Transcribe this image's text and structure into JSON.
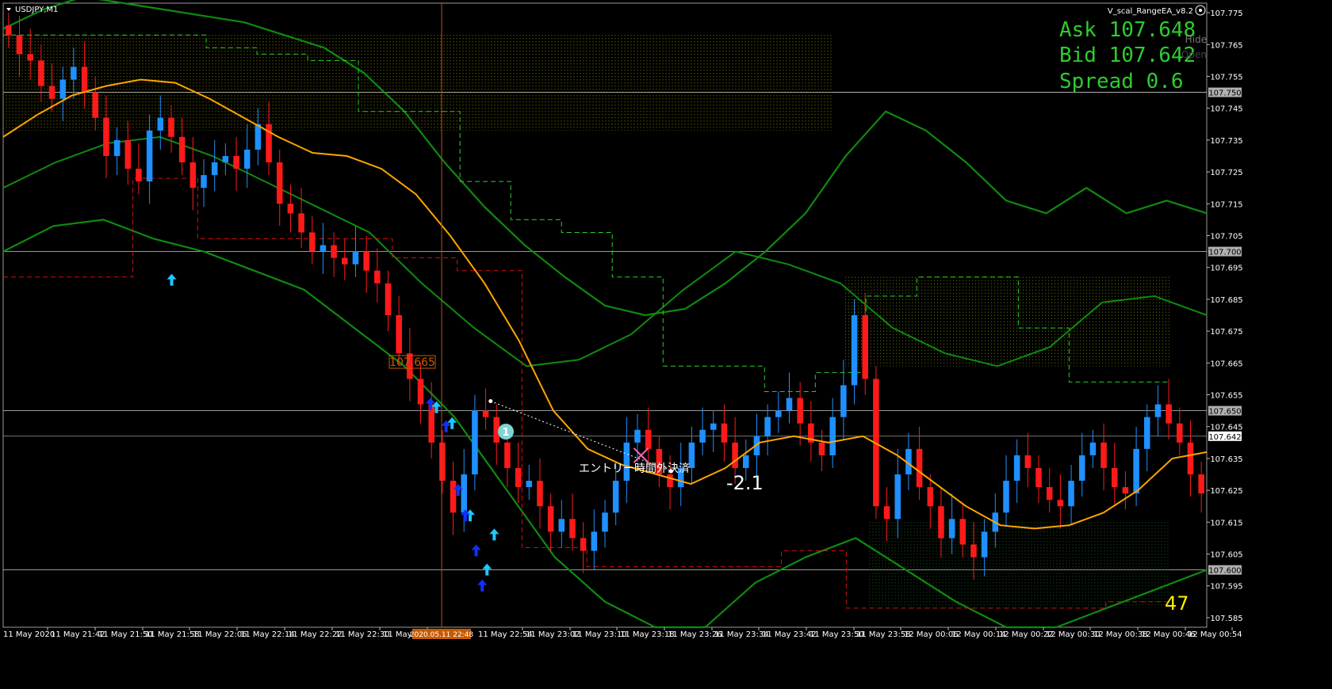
{
  "window": {
    "symbol_title": "USDJPY,M1",
    "ea_name": "V_scal_RangeEA_v8.2",
    "hide_label": "Hide",
    "open_label": "Open"
  },
  "panel": {
    "ask": "Ask 107.648",
    "bid": "Bid 107.642",
    "spread": "Spread 0.6"
  },
  "annotations": {
    "price_label": "107.665",
    "trade_number": "1",
    "exit_text": "エントリー時間外決済",
    "profit_text": "-2.1",
    "counter": "47",
    "crosshair_time": "2020.05.11 22:48"
  },
  "colors": {
    "bull": "#1e90ff",
    "bear": "#ff1a1a",
    "ma": "#ffa500",
    "bands": "#0f8a0f",
    "green_dash": "#2ecc2e",
    "red_dash": "#d01010",
    "arrow_light": "#1ec8ff",
    "arrow_dark": "#1030ff",
    "text_green": "#2ecc2e"
  },
  "chart_data": {
    "type": "candlestick",
    "symbol": "USDJPY",
    "timeframe": "M1",
    "ylim": [
      107.582,
      107.778
    ],
    "yticks": [
      "107.775",
      "107.765",
      "107.755",
      "107.745",
      "107.735",
      "107.725",
      "107.715",
      "107.705",
      "107.695",
      "107.685",
      "107.675",
      "107.665",
      "107.655",
      "107.645",
      "107.635",
      "107.625",
      "107.615",
      "107.605",
      "107.595",
      "107.585"
    ],
    "ylabels_highlight": [
      {
        "label": "107.750",
        "value": 107.75
      },
      {
        "label": "107.700",
        "value": 107.7
      },
      {
        "label": "107.650",
        "value": 107.65
      },
      {
        "label": "107.642",
        "value": 107.642
      },
      {
        "label": "107.600",
        "value": 107.6
      }
    ],
    "xlabels": [
      "11 May 2020",
      "11 May 21:42",
      "11 May 21:50",
      "11 May 21:58",
      "11 May 22:06",
      "11 May 22:14",
      "11 May 22:22",
      "11 May 22:30",
      "11 May 2",
      "11 May 22:54",
      "11 May 23:02",
      "11 May 23:10",
      "11 May 23:18",
      "11 May 23:26",
      "11 May 23:34",
      "11 May 23:42",
      "11 May 23:50",
      "11 May 23:58",
      "12 May 00:06",
      "12 May 00:14",
      "12 May 00:22",
      "12 May 00:30",
      "12 May 00:38",
      "12 May 00:46",
      "12 May 00:54"
    ],
    "close_path": [
      107.768,
      107.762,
      107.76,
      107.752,
      107.748,
      107.754,
      107.758,
      107.75,
      107.742,
      107.73,
      107.735,
      107.726,
      107.722,
      107.738,
      107.742,
      107.736,
      107.728,
      107.72,
      107.724,
      107.728,
      107.73,
      107.726,
      107.732,
      107.74,
      107.728,
      107.715,
      107.712,
      107.706,
      107.7,
      107.702,
      107.698,
      107.696,
      107.7,
      107.694,
      107.69,
      107.68,
      107.668,
      107.66,
      107.652,
      107.64,
      107.628,
      107.618,
      107.63,
      107.65,
      107.648,
      107.64,
      107.632,
      107.626,
      107.628,
      107.62,
      107.612,
      107.616,
      107.61,
      107.606,
      107.612,
      107.618,
      107.628,
      107.64,
      107.644,
      107.638,
      107.63,
      107.626,
      107.632,
      107.64,
      107.644,
      107.646,
      107.64,
      107.632,
      107.636,
      107.642,
      107.648,
      107.65,
      107.654,
      107.646,
      107.64,
      107.636,
      107.648,
      107.658,
      107.68,
      107.66,
      107.62,
      107.616,
      107.63,
      107.638,
      107.626,
      107.62,
      107.61,
      107.616,
      107.608,
      107.604,
      107.612,
      107.618,
      107.628,
      107.636,
      107.632,
      107.626,
      107.622,
      107.62,
      107.628,
      107.636,
      107.64,
      107.632,
      107.626,
      107.624,
      107.638,
      107.648,
      107.652,
      107.646,
      107.64,
      107.63,
      107.624
    ],
    "ma": [
      107.736,
      107.743,
      107.749,
      107.752,
      107.754,
      107.753,
      107.748,
      107.742,
      107.736,
      107.731,
      107.73,
      107.726,
      107.718,
      107.705,
      107.69,
      107.672,
      107.65,
      107.638,
      107.633,
      107.63,
      107.627,
      107.632,
      107.64,
      107.642,
      107.64,
      107.642,
      107.636,
      107.628,
      107.62,
      107.614,
      107.613,
      107.614,
      107.618,
      107.625,
      107.635,
      107.637
    ],
    "upper_band": [
      107.77,
      107.776,
      107.78,
      107.778,
      107.776,
      107.774,
      107.772,
      107.768,
      107.764,
      107.756,
      107.744,
      107.728,
      107.714,
      107.702,
      107.692,
      107.683,
      107.68,
      107.682,
      107.69,
      107.7,
      107.712,
      107.73,
      107.744,
      107.738,
      107.728,
      107.716,
      107.712,
      107.72,
      107.712,
      107.716,
      107.712
    ],
    "middle_band": [
      107.72,
      107.728,
      107.734,
      107.736,
      107.73,
      107.722,
      107.714,
      107.706,
      107.69,
      107.676,
      107.664,
      107.666,
      107.674,
      107.688,
      107.7,
      107.696,
      107.69,
      107.676,
      107.668,
      107.664,
      107.67,
      107.684,
      107.686,
      107.68
    ],
    "lower_band": [
      107.7,
      107.708,
      107.71,
      107.704,
      107.7,
      107.694,
      107.688,
      107.676,
      107.664,
      107.648,
      107.626,
      107.604,
      107.59,
      107.582,
      107.582,
      107.596,
      107.604,
      107.61,
      107.6,
      107.59,
      107.582,
      107.582,
      107.588,
      107.594,
      107.6
    ],
    "dashed_upper": [
      107.768,
      107.768,
      107.768,
      107.768,
      107.764,
      107.762,
      107.76,
      107.744,
      107.744,
      107.722,
      107.71,
      107.706,
      107.692,
      107.664,
      107.664,
      107.656,
      107.662,
      107.686,
      107.692,
      107.692,
      107.676,
      107.659,
      107.659
    ],
    "dashed_lower": [
      107.692,
      107.692,
      107.723,
      107.704,
      107.704,
      107.704,
      107.698,
      107.694,
      107.607,
      107.601,
      107.601,
      107.601,
      107.606,
      107.588,
      107.588,
      107.588,
      107.588,
      107.59
    ],
    "range_boxes": [
      {
        "t0": 0.0,
        "t1": 0.69,
        "v0": 107.738,
        "v1": 107.768
      },
      {
        "t0": 0.7,
        "t1": 0.97,
        "v0": 107.664,
        "v1": 107.692
      },
      {
        "t0": 0.72,
        "t1": 0.97,
        "v0": 107.588,
        "v1": 107.615
      }
    ],
    "trade": {
      "entry": {
        "t": 0.405,
        "v": 107.653
      },
      "exit": {
        "t": 0.53,
        "v": 107.636
      },
      "close_marker": {
        "t": 0.555,
        "v": 107.631
      }
    },
    "buy_arrows_light": [
      {
        "t": 0.14,
        "v": 107.691
      },
      {
        "t": 0.36,
        "v": 107.651
      },
      {
        "t": 0.373,
        "v": 107.646
      },
      {
        "t": 0.388,
        "v": 107.617
      },
      {
        "t": 0.408,
        "v": 107.611
      },
      {
        "t": 0.402,
        "v": 107.6
      }
    ],
    "buy_arrows_dark": [
      {
        "t": 0.355,
        "v": 107.652
      },
      {
        "t": 0.368,
        "v": 107.645
      },
      {
        "t": 0.378,
        "v": 107.625
      },
      {
        "t": 0.384,
        "v": 107.617
      },
      {
        "t": 0.393,
        "v": 107.606
      },
      {
        "t": 0.398,
        "v": 107.595
      }
    ]
  }
}
